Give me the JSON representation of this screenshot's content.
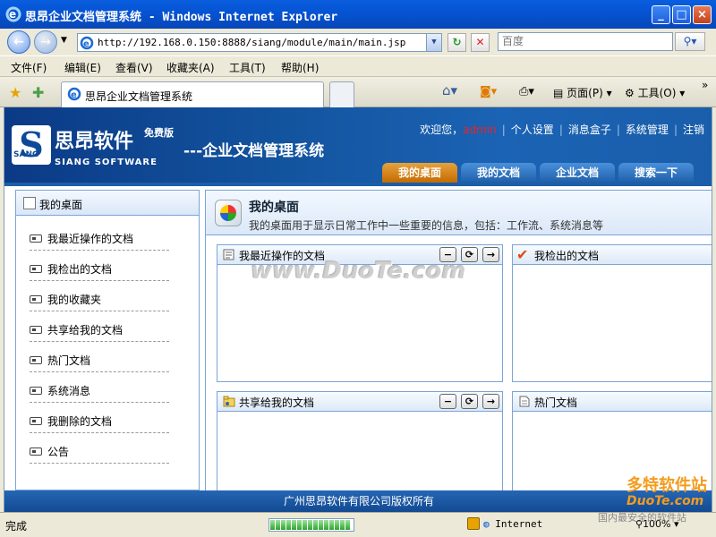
{
  "window": {
    "title": "思昂企业文档管理系统 - Windows Internet Explorer"
  },
  "toolbar": {
    "address": "http://192.168.0.150:8888/siang/module/main/main.jsp",
    "search_placeholder": "百度"
  },
  "menu": [
    "文件(F)",
    "编辑(E)",
    "查看(V)",
    "收藏夹(A)",
    "工具(T)",
    "帮助(H)"
  ],
  "tab": {
    "title": "思昂企业文档管理系统"
  },
  "browser_tools": {
    "page": "页面(P)",
    "tools": "工具(O)"
  },
  "header": {
    "logo_cn": "思昂软件",
    "logo_free": "免费版",
    "logo_en": "SIANG SOFTWARE",
    "logo_sang": "SANG",
    "logo_s": "S",
    "subtitle": "---企业文档管理系统",
    "welcome": "欢迎您，",
    "user": "admin",
    "links": [
      "个人设置",
      "消息盒子",
      "系统管理",
      "注销"
    ]
  },
  "nav_tabs": [
    "我的桌面",
    "我的文档",
    "企业文档",
    "搜索一下"
  ],
  "sidebar": {
    "title": "我的桌面",
    "items": [
      "我最近操作的文档",
      "我检出的文档",
      "我的收藏夹",
      "共享给我的文档",
      "热门文档",
      "系统消息",
      "我删除的文档",
      "公告"
    ]
  },
  "main": {
    "title": "我的桌面",
    "description": "我的桌面用于显示日常工作中一些重要的信息，包括：工作流、系统消息等",
    "portlets": [
      "我最近操作的文档",
      "我检出的文档",
      "共享给我的文档",
      "热门文档"
    ]
  },
  "footer": "广州思昂软件有限公司版权所有",
  "status": {
    "text": "完成",
    "zone": "Internet",
    "zoom": "100%"
  },
  "watermarks": {
    "center": "www.DuoTe.com",
    "corner1": "多特软件站",
    "corner2": "DuoTe.com",
    "corner3": "国内最安全的软件站"
  },
  "colors": {
    "accent_orange": "#c46b00",
    "banner_blue": "#13549f",
    "user_red": "#e22"
  }
}
